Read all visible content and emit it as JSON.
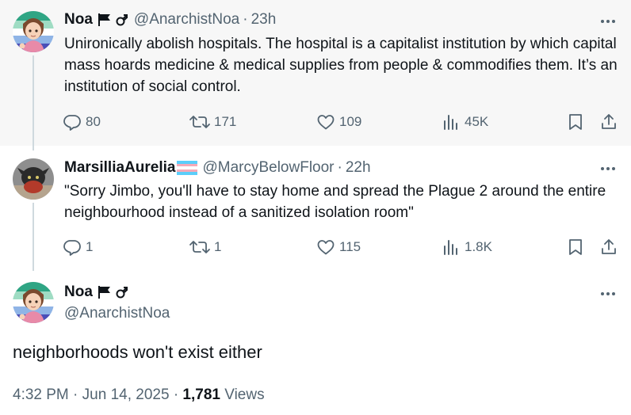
{
  "thread": [
    {
      "name": "Noa",
      "handle": "@AnarchistNoa",
      "separator": "·",
      "time": "23h",
      "text": "Unironically abolish hospitals. The hospital is a capitalist institution by which capital mass hoards medicine & medical supplies from people & commodifies them. It’s an institution of social control.",
      "stats": {
        "replies": "80",
        "reposts": "171",
        "likes": "109",
        "views": "45K"
      }
    },
    {
      "name": "MarsilliaAurelia",
      "handle": "@MarcyBelowFloor",
      "separator": "·",
      "time": "22h",
      "text": "\"Sorry Jimbo, you'll have to stay home and spread the Plague 2 around the entire neighbourhood instead of a sanitized isolation room\"",
      "stats": {
        "replies": "1",
        "reposts": "1",
        "likes": "115",
        "views": "1.8K"
      }
    }
  ],
  "main_post": {
    "name": "Noa",
    "handle": "@AnarchistNoa",
    "text": "neighborhoods won't exist either",
    "time": "4:32 PM",
    "date_separator": "·",
    "date": "Jun 14, 2025",
    "views_separator": "·",
    "views_count": "1,781",
    "views_label": "Views"
  },
  "colors": {
    "text": "#0f1419",
    "secondary": "#536471",
    "highlight_background": "#f7f7f7",
    "thread_line": "#cfd9de"
  }
}
